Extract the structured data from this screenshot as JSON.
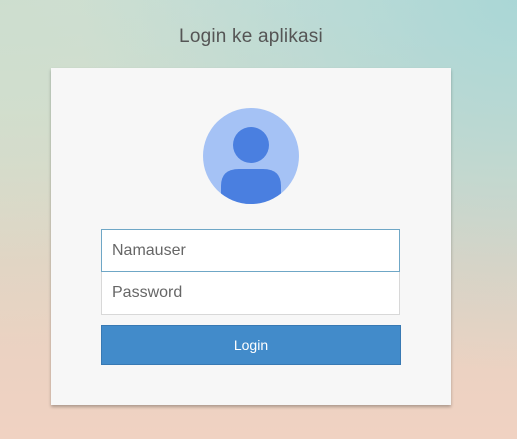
{
  "login": {
    "heading": "Login ke aplikasi",
    "avatar_icon": "user-avatar-icon",
    "username": {
      "placeholder": "Namauser",
      "value": ""
    },
    "password": {
      "placeholder": "Password",
      "value": ""
    },
    "button_label": "Login"
  },
  "colors": {
    "button": "#428bca",
    "avatar_background": "#a5c2f5",
    "avatar_figure": "#4a7fe0",
    "card": "#f7f7f7"
  }
}
